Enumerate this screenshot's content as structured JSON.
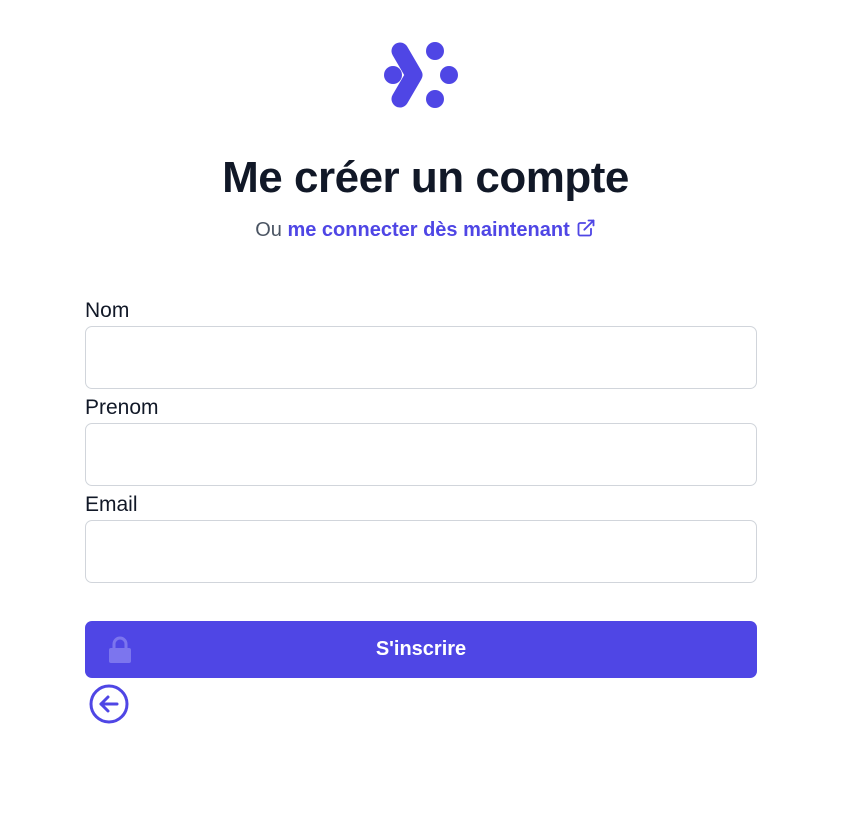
{
  "header": {
    "logo_icon": "brand-dots-chevron-icon",
    "title": "Me créer un compte",
    "subtitle_prefix": "Ou",
    "login_link": "me connecter dès maintenant",
    "login_link_icon": "external-link-icon"
  },
  "form": {
    "fields": [
      {
        "label": "Nom",
        "value": "",
        "placeholder": ""
      },
      {
        "label": "Prenom",
        "value": "",
        "placeholder": ""
      },
      {
        "label": "Email",
        "value": "",
        "placeholder": ""
      }
    ],
    "submit_label": "S'inscrire",
    "submit_icon": "lock-icon",
    "back_icon": "arrow-left-circle-icon"
  },
  "colors": {
    "accent": "#4f46e5",
    "title": "#111827",
    "muted": "#4b5563",
    "border": "#d1d5db"
  }
}
